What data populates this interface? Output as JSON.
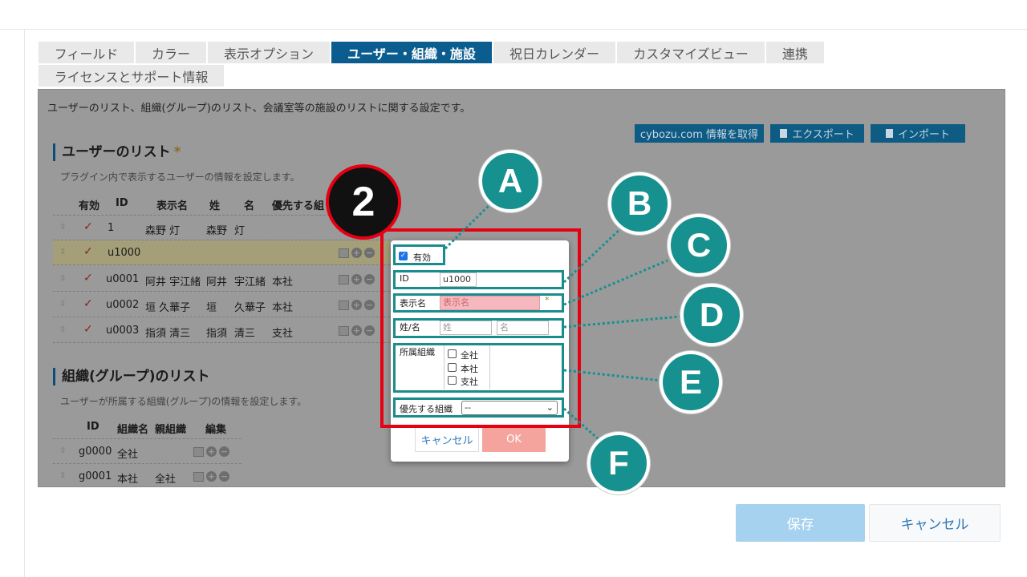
{
  "tabs": [
    {
      "label": "フィールド",
      "active": false
    },
    {
      "label": "カラー",
      "active": false
    },
    {
      "label": "表示オプション",
      "active": false
    },
    {
      "label": "ユーザー・組織・施設",
      "active": true
    },
    {
      "label": "祝日カレンダー",
      "active": false
    },
    {
      "label": "カスタマイズビュー",
      "active": false
    },
    {
      "label": "連携",
      "active": false
    },
    {
      "label": "ライセンスとサポート情報",
      "active": false
    }
  ],
  "panel": {
    "description": "ユーザーのリスト、組織(グループ)のリスト、会議室等の施設のリストに関する設定です。",
    "buttons": {
      "cybozu": "cybozu.com 情報を取得",
      "export": "エクスポート",
      "import": "インポート"
    }
  },
  "user_list": {
    "title": "ユーザーのリスト",
    "required_mark": "*",
    "description": "プラグイン内で表示するユーザーの情報を設定します。",
    "headers": [
      "有効",
      "ID",
      "表示名",
      "姓",
      "名",
      "優先する組"
    ],
    "rows": [
      {
        "enabled": "✓",
        "id": "1",
        "display": "森野 灯",
        "last": "森野",
        "first": "灯",
        "org": ""
      },
      {
        "enabled": "✓",
        "id": "u1000",
        "display": "",
        "last": "",
        "first": "",
        "org": ""
      },
      {
        "enabled": "✓",
        "id": "u0001",
        "display": "阿井 宇江緒",
        "last": "阿井",
        "first": "宇江緒",
        "org": "本社"
      },
      {
        "enabled": "✓",
        "id": "u0002",
        "display": "垣 久華子",
        "last": "垣",
        "first": "久華子",
        "org": "本社"
      },
      {
        "enabled": "✓",
        "id": "u0003",
        "display": "指須 清三",
        "last": "指須",
        "first": "清三",
        "org": "支社"
      }
    ]
  },
  "org_list": {
    "title": "組織(グループ)のリスト",
    "description": "ユーザーが所属する組織(グループ)の情報を設定します。",
    "headers": [
      "ID",
      "組織名",
      "親組織",
      "編集"
    ],
    "rows": [
      {
        "id": "g0000",
        "name": "全社",
        "parent": ""
      },
      {
        "id": "g0001",
        "name": "本社",
        "parent": "全社"
      }
    ]
  },
  "dialog": {
    "enabled_label": "有効",
    "id_label": "ID",
    "id_value": "u1000",
    "display_label": "表示名",
    "display_placeholder": "表示名",
    "required_mark": "*",
    "name_label": "姓/名",
    "last_placeholder": "姓",
    "first_placeholder": "名",
    "org_label": "所属組織",
    "orgs": [
      "全社",
      "本社",
      "支社"
    ],
    "priority_label": "優先する組織",
    "priority_value": "--",
    "cancel": "キャンセル",
    "ok": "OK"
  },
  "callouts": {
    "step": "2",
    "a": "A",
    "b": "B",
    "c": "C",
    "d": "D",
    "e": "E",
    "f": "F"
  },
  "footer": {
    "save": "保存",
    "cancel": "キャンセル"
  },
  "colors": {
    "teal": "#16918f",
    "red": "#e60012",
    "active_tab": "#0b5d8f"
  }
}
